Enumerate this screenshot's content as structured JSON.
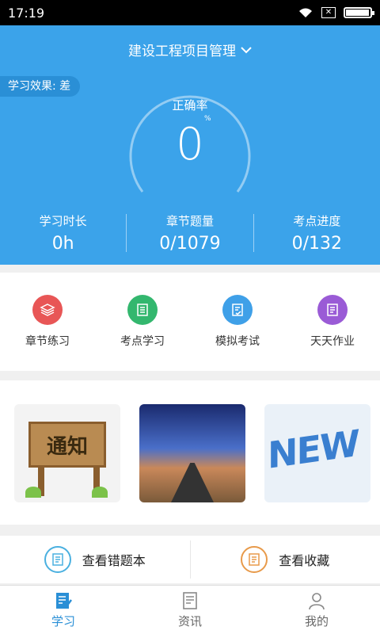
{
  "status_bar": {
    "time": "17:19",
    "icons": [
      "wifi-icon",
      "sim-icon",
      "battery-icon"
    ],
    "battery_level": 0.9
  },
  "header": {
    "project_title": "建设工程项目管理",
    "dropdown_icon": "chevron-down-icon"
  },
  "effect": {
    "label": "学习效果: 差"
  },
  "accuracy": {
    "label": "正确率",
    "unit": "%",
    "value": "0"
  },
  "stats": [
    {
      "label": "学习时长",
      "value": "0h"
    },
    {
      "label": "章节题量",
      "value": "0/1079"
    },
    {
      "label": "考点进度",
      "value": "0/132"
    }
  ],
  "quick_actions": [
    {
      "label": "章节练习",
      "icon": "layers-icon",
      "color": "#e85656"
    },
    {
      "label": "考点学习",
      "icon": "list-icon",
      "color": "#33b76e"
    },
    {
      "label": "模拟考试",
      "icon": "exam-icon",
      "color": "#3fa0e8"
    },
    {
      "label": "天天作业",
      "icon": "document-icon",
      "color": "#9a5bd6"
    }
  ],
  "banners": [
    {
      "text": "通知"
    },
    {
      "text": ""
    },
    {
      "text": "NEW"
    }
  ],
  "bottom_links": [
    {
      "label": "查看错题本",
      "icon": "wrong-book-icon",
      "color": "#4ab0e0"
    },
    {
      "label": "查看收藏",
      "icon": "favorite-icon",
      "color": "#e89a4a"
    }
  ],
  "tabs": [
    {
      "label": "学习",
      "icon": "study-icon",
      "active": true
    },
    {
      "label": "资讯",
      "icon": "news-icon",
      "active": false
    },
    {
      "label": "我的",
      "icon": "profile-icon",
      "active": false
    }
  ],
  "colors": {
    "primary": "#3ba3ea",
    "accent": "#2a8fd6"
  }
}
